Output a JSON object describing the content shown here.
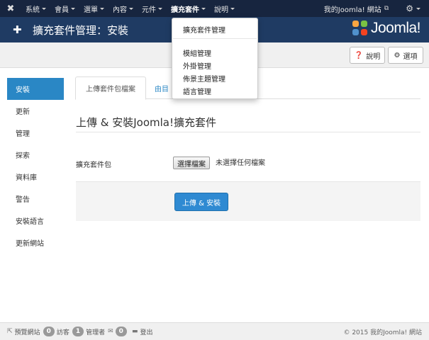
{
  "topnav": {
    "items": [
      {
        "label": "系統"
      },
      {
        "label": "會員"
      },
      {
        "label": "選單"
      },
      {
        "label": "內容"
      },
      {
        "label": "元件"
      },
      {
        "label": "擴充套件"
      },
      {
        "label": "說明"
      }
    ],
    "site_link": "我的Joomla! 網站"
  },
  "header": {
    "title": "擴充套件管理：安裝",
    "logo_text": "Joomla!"
  },
  "toolbar": {
    "help_label": "說明",
    "options_label": "選項"
  },
  "dropdown": {
    "items": [
      {
        "label": "擴充套件管理"
      },
      {
        "label": "模組管理"
      },
      {
        "label": "外掛管理"
      },
      {
        "label": "佈景主題管理"
      },
      {
        "label": "語言管理"
      }
    ]
  },
  "sidebar": {
    "items": [
      {
        "label": "安裝"
      },
      {
        "label": "更新"
      },
      {
        "label": "管理"
      },
      {
        "label": "探索"
      },
      {
        "label": "資料庫"
      },
      {
        "label": "警告"
      },
      {
        "label": "安裝語言"
      },
      {
        "label": "更新網站"
      }
    ]
  },
  "tabs": [
    {
      "label": "上傳套件包檔案"
    },
    {
      "label": "由目"
    }
  ],
  "main": {
    "section_title": "上傳 & 安裝Joomla!擴充套件",
    "field_label": "擴充套件包",
    "file_button": "選擇檔案",
    "file_status": "未選擇任何檔案",
    "upload_button": "上傳 & 安裝"
  },
  "footer": {
    "preview_label": "預覽網站",
    "visitors_count": "0",
    "visitors_label": "訪客",
    "admins_count": "1",
    "admins_label": "管理者",
    "messages_count": "0",
    "logout_label": "登出",
    "copyright": "© 2015 我的Joomla! 網站"
  },
  "colors": {
    "navbar": "#17253f",
    "header": "#1f3b63",
    "accent": "#2a87c5",
    "primary_button": "#2f8ad2"
  }
}
